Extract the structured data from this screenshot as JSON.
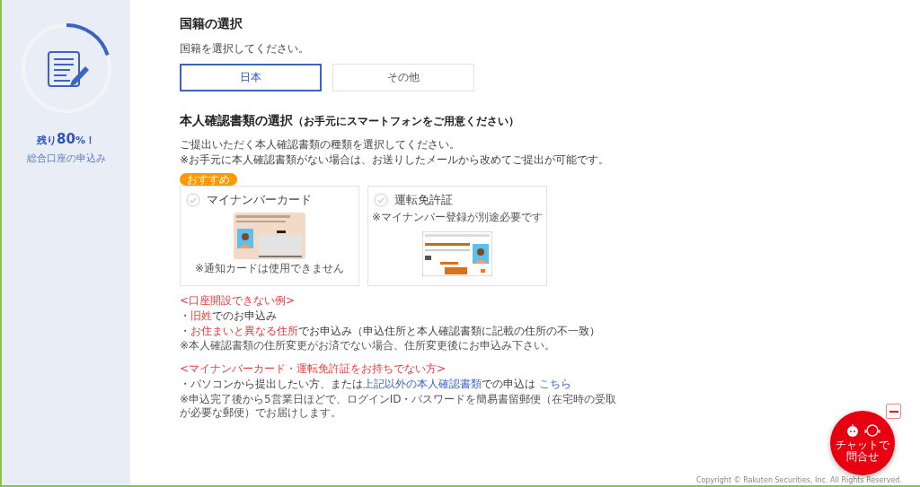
{
  "sidebar": {
    "progress": {
      "level": 0.2
    },
    "remaining": {
      "prefix": "残り",
      "value": "80",
      "suffix": "%！"
    },
    "subtitle": "総合口座の申込み"
  },
  "nationality": {
    "heading": "国籍の選択",
    "hint": "国籍を選択してください。",
    "options": [
      {
        "label": "日本",
        "selected": true
      },
      {
        "label": "その他",
        "selected": false
      }
    ]
  },
  "id_documents": {
    "heading": "本人確認書類の選択",
    "heading_note": "（お手元にスマートフォンをご用意ください）",
    "intro": [
      "ご提出いただく本人確認書類の種類を選択してください。",
      "※お手元に本人確認書類がない場合は、お送りしたメールから改めてご提出が可能です。"
    ],
    "cards": [
      {
        "kind": "mynumber",
        "badge": "おすすめ",
        "title": "マイナンバーカード",
        "note": "※通知カードは使用できません",
        "checked": false
      },
      {
        "kind": "license",
        "title": "運転免許証",
        "note": "※マイナンバー登録が別途必要です",
        "checked": false
      }
    ]
  },
  "notices": [
    {
      "heading": "<口座開設できない例>",
      "lines": [
        {
          "kind": "bullet",
          "segments": [
            {
              "kind": "plain",
              "text": "・"
            },
            {
              "kind": "red",
              "text": "旧姓"
            },
            {
              "kind": "plain",
              "text": "でのお申込み"
            }
          ]
        },
        {
          "kind": "bullet",
          "segments": [
            {
              "kind": "plain",
              "text": "・"
            },
            {
              "kind": "red",
              "text": "お住まいと異なる住所"
            },
            {
              "kind": "plain",
              "text": "でお申込み（申込住所と本人確認書類に記載の住所の不一致）"
            }
          ]
        },
        {
          "kind": "note",
          "segments": [
            {
              "kind": "plain",
              "text": "※本人確認書類の住所変更がお済でない場合、住所変更後にお申込み下さい。"
            }
          ]
        }
      ]
    },
    {
      "heading": "<マイナンバーカード・運転免許証をお持ちでない方>",
      "lines": [
        {
          "kind": "bullet",
          "segments": [
            {
              "kind": "plain",
              "text": "・パソコンから提出したい方、または"
            },
            {
              "kind": "blue",
              "text": "上記以外の本人確認書類"
            },
            {
              "kind": "plain",
              "text": "での申込は "
            },
            {
              "kind": "link",
              "text": "こちら"
            }
          ]
        },
        {
          "kind": "note",
          "segments": [
            {
              "kind": "plain",
              "text": "※申込完了後から5営業日ほどで、ログインID・パスワードを簡易書留郵便（在宅時の受取が必要な郵便）でお届けします。"
            }
          ]
        }
      ]
    }
  ],
  "chat": {
    "label_lines": [
      "チャットで",
      "問合せ"
    ]
  },
  "footer": "Copyright © Rakuten Securities, Inc. All Rights Reserved."
}
